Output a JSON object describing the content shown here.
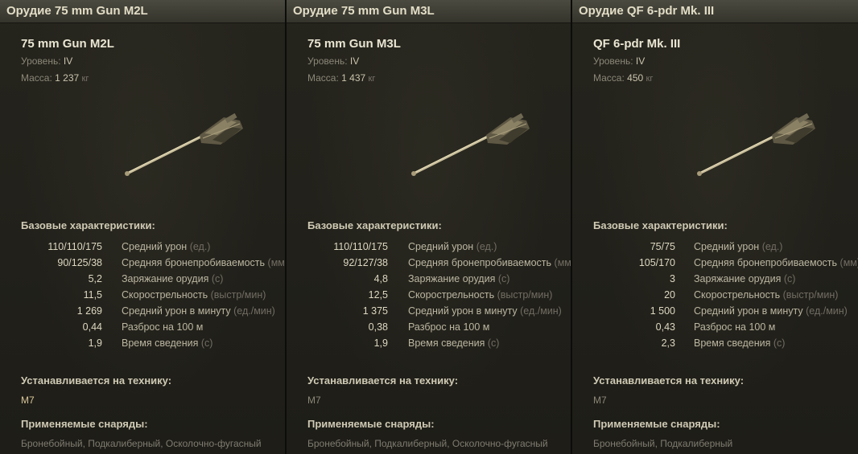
{
  "panels": [
    {
      "title": "Орудие 75 mm Gun M2L",
      "gun_name": "75 mm Gun M2L",
      "level_label": "Уровень:",
      "level_value": "IV",
      "mass_label": "Масса:",
      "mass_value": "1 237",
      "mass_unit": "кг",
      "base_label": "Базовые характеристики:",
      "stats": [
        {
          "value": "110/110/175",
          "name": "Средний урон",
          "unit": "(ед.)"
        },
        {
          "value": "90/125/38",
          "name": "Средняя бронепробиваемость",
          "unit": "(мм)"
        },
        {
          "value": "5,2",
          "name": "Заряжание орудия",
          "unit": "(с)"
        },
        {
          "value": "11,5",
          "name": "Скорострельность",
          "unit": "(выстр/мин)"
        },
        {
          "value": "1 269",
          "name": "Средний урон в минуту",
          "unit": "(ед./мин)"
        },
        {
          "value": "0,44",
          "name": "Разброс на 100 м",
          "unit": ""
        },
        {
          "value": "1,9",
          "name": "Время сведения",
          "unit": "(с)"
        }
      ],
      "tech_label": "Устанавливается на технику:",
      "tech_value": "M7",
      "tech_color": "#d9c79a",
      "shells_label": "Применяемые снаряды:",
      "shells_value": "Бронебойный, Подкалиберный, Осколочно-фугасный"
    },
    {
      "title": "Орудие 75 mm Gun M3L",
      "gun_name": "75 mm Gun M3L",
      "level_label": "Уровень:",
      "level_value": "IV",
      "mass_label": "Масса:",
      "mass_value": "1 437",
      "mass_unit": "кг",
      "base_label": "Базовые характеристики:",
      "stats": [
        {
          "value": "110/110/175",
          "name": "Средний урон",
          "unit": "(ед.)"
        },
        {
          "value": "92/127/38",
          "name": "Средняя бронепробиваемость",
          "unit": "(мм)"
        },
        {
          "value": "4,8",
          "name": "Заряжание орудия",
          "unit": "(с)"
        },
        {
          "value": "12,5",
          "name": "Скорострельность",
          "unit": "(выстр/мин)"
        },
        {
          "value": "1 375",
          "name": "Средний урон в минуту",
          "unit": "(ед./мин)"
        },
        {
          "value": "0,38",
          "name": "Разброс на 100 м",
          "unit": ""
        },
        {
          "value": "1,9",
          "name": "Время сведения",
          "unit": "(с)"
        }
      ],
      "tech_label": "Устанавливается на технику:",
      "tech_value": "M7",
      "tech_color": "#8b8878",
      "shells_label": "Применяемые снаряды:",
      "shells_value": "Бронебойный, Подкалиберный, Осколочно-фугасный"
    },
    {
      "title": "Орудие QF 6-pdr Mk. III",
      "gun_name": "QF 6-pdr Mk. III",
      "level_label": "Уровень:",
      "level_value": "IV",
      "mass_label": "Масса:",
      "mass_value": "450",
      "mass_unit": "кг",
      "base_label": "Базовые характеристики:",
      "stats": [
        {
          "value": "75/75",
          "name": "Средний урон",
          "unit": "(ед.)"
        },
        {
          "value": "105/170",
          "name": "Средняя бронепробиваемость",
          "unit": "(мм)"
        },
        {
          "value": "3",
          "name": "Заряжание орудия",
          "unit": "(с)"
        },
        {
          "value": "20",
          "name": "Скорострельность",
          "unit": "(выстр/мин)"
        },
        {
          "value": "1 500",
          "name": "Средний урон в минуту",
          "unit": "(ед./мин)"
        },
        {
          "value": "0,43",
          "name": "Разброс на 100 м",
          "unit": ""
        },
        {
          "value": "2,3",
          "name": "Время сведения",
          "unit": "(с)"
        }
      ],
      "tech_label": "Устанавливается на технику:",
      "tech_value": "M7",
      "tech_color": "#8b8878",
      "shells_label": "Применяемые снаряды:",
      "shells_value": "Бронебойный, Подкалиберный"
    }
  ]
}
